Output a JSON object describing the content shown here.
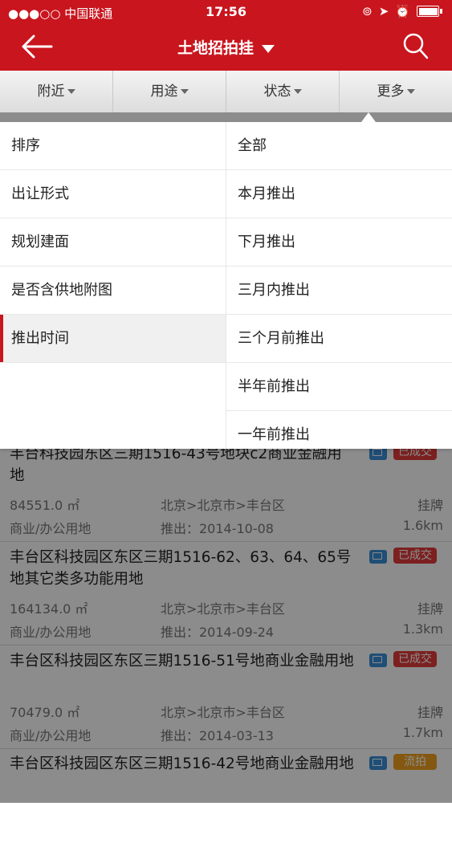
{
  "status": {
    "carrier": "●●●○○ 中国联通",
    "time": "17:56"
  },
  "header": {
    "title": "土地招拍挂"
  },
  "filters": [
    "附近",
    "用途",
    "状态",
    "更多"
  ],
  "menu": {
    "left": [
      "排序",
      "出让形式",
      "规划建面",
      "是否含供地附图",
      "推出时间"
    ],
    "active": "推出时间",
    "right": [
      "全部",
      "本月推出",
      "下月推出",
      "三月内推出",
      "三个月前推出",
      "半年前推出",
      "一年前推出"
    ]
  },
  "list": [
    {
      "title": "丰台科技园东区三期1516-43号地块c2商业金融用地",
      "badge": "已成交",
      "area": "84551.0 ㎡",
      "region": "北京>北京市>丰台区",
      "mode": "挂牌",
      "use": "商业/办公用地",
      "date": "推出：2014-10-08",
      "distance": "1.6km"
    },
    {
      "title": "丰台区科技园区东区三期1516-62、63、64、65号地其它类多功能用地",
      "badge": "已成交",
      "area": "164134.0 ㎡",
      "region": "北京>北京市>丰台区",
      "mode": "挂牌",
      "use": "商业/办公用地",
      "date": "推出：2014-09-24",
      "distance": "1.3km"
    },
    {
      "title": "丰台区科技园区东区三期1516-51号地商业金融用地",
      "badge": "已成交",
      "area": "70479.0 ㎡",
      "region": "北京>北京市>丰台区",
      "mode": "挂牌",
      "use": "商业/办公用地",
      "date": "推出：2014-03-13",
      "distance": "1.7km"
    },
    {
      "title": "丰台区科技园区东区三期1516-42号地商业金融用地",
      "badge": "流拍",
      "area": "",
      "region": "",
      "mode": "",
      "use": "",
      "date": "",
      "distance": ""
    }
  ],
  "colors": {
    "brand": "#c9151e",
    "badge_done": "#e23b3b",
    "badge_fail": "#f0a020",
    "icon": "#3a8fd8"
  }
}
